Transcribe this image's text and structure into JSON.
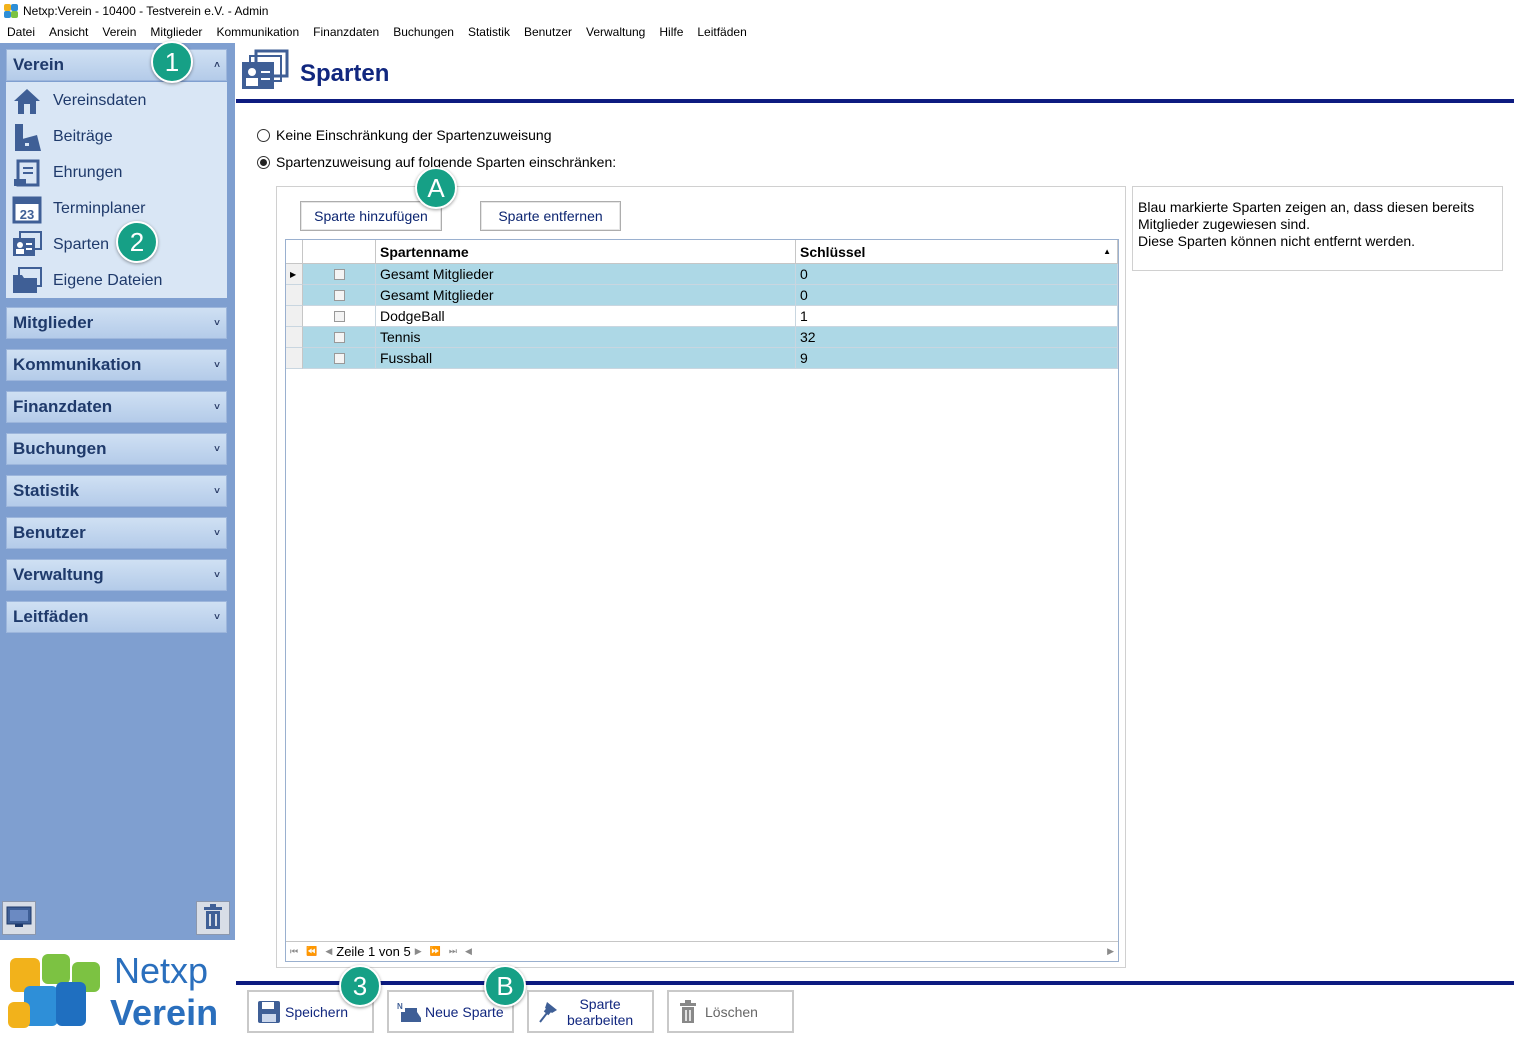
{
  "window": {
    "title": "Netxp:Verein - 10400 - Testverein e.V. - Admin"
  },
  "menu": [
    "Datei",
    "Ansicht",
    "Verein",
    "Mitglieder",
    "Kommunikation",
    "Finanzdaten",
    "Buchungen",
    "Statistik",
    "Benutzer",
    "Verwaltung",
    "Hilfe",
    "Leitfäden"
  ],
  "sidebar": {
    "expanded_group": "Verein",
    "items": [
      {
        "label": "Vereinsdaten",
        "icon": "house-icon"
      },
      {
        "label": "Beiträge",
        "icon": "register-icon"
      },
      {
        "label": "Ehrungen",
        "icon": "certificate-icon"
      },
      {
        "label": "Terminplaner",
        "icon": "calendar-icon",
        "calendar_day": "23"
      },
      {
        "label": "Sparten",
        "icon": "member-cards-icon"
      },
      {
        "label": "Eigene Dateien",
        "icon": "folder-icon"
      }
    ],
    "groups": [
      "Mitglieder",
      "Kommunikation",
      "Finanzdaten",
      "Buchungen",
      "Statistik",
      "Benutzer",
      "Verwaltung",
      "Leitfäden"
    ],
    "logo": {
      "line1": "Netxp",
      "line2": "Verein"
    }
  },
  "badges": {
    "b1": "1",
    "b2": "2",
    "b3": "3",
    "bA": "A",
    "bB": "B"
  },
  "page": {
    "title": "Sparten",
    "radio_none": "Keine Einschränkung der Spartenzuweisung",
    "radio_restrict": "Spartenzuweisung auf folgende Sparten einschränken:",
    "selected_radio": "restrict",
    "add_button": "Sparte hinzufügen",
    "remove_button": "Sparte entfernen",
    "info": {
      "line1": "Blau markierte Sparten zeigen an, dass diesen bereits",
      "line2": "Mitglieder zugewiesen sind.",
      "line3": "Diese Sparten können nicht entfernt werden."
    }
  },
  "grid": {
    "columns": {
      "name": "Spartenname",
      "key": "Schlüssel"
    },
    "rows": [
      {
        "name": "Gesamt Mitglieder",
        "key": "0",
        "highlighted": true,
        "current": true
      },
      {
        "name": "Gesamt Mitglieder",
        "key": "0",
        "highlighted": true,
        "current": false
      },
      {
        "name": "DodgeBall",
        "key": "1",
        "highlighted": false,
        "current": false
      },
      {
        "name": "Tennis",
        "key": "32",
        "highlighted": true,
        "current": false
      },
      {
        "name": "Fussball",
        "key": "9",
        "highlighted": true,
        "current": false
      }
    ],
    "pager": "Zeile 1 von 5"
  },
  "toolbar": {
    "save": "Speichern",
    "new": "Neue Sparte",
    "edit_line1": "Sparte",
    "edit_line2": "bearbeiten",
    "delete": "Löschen"
  },
  "colors": {
    "highlight_row": "#add8e6",
    "accent": "#0d1b80",
    "sidebar": "#7f9fd0",
    "badge": "#16a086"
  }
}
